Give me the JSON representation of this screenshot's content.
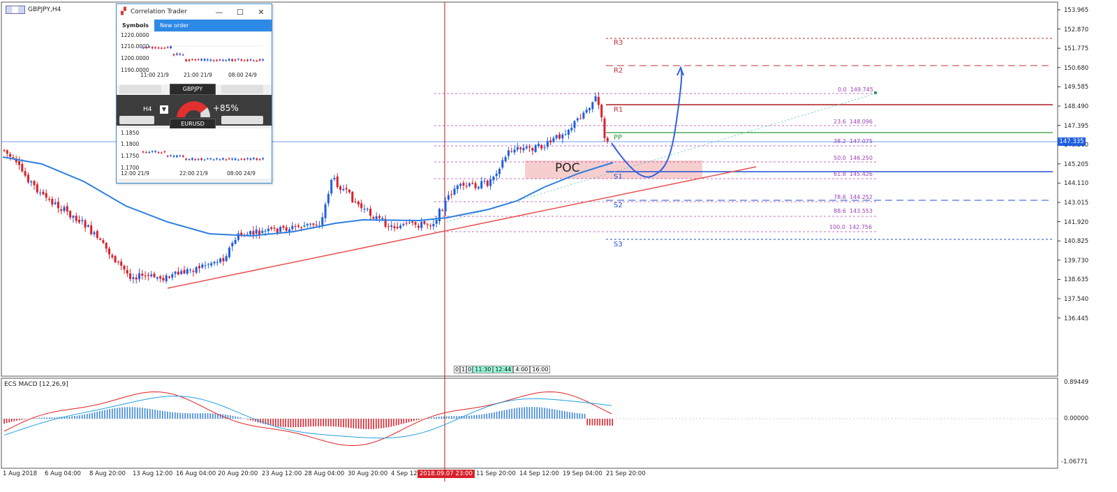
{
  "chart": {
    "symbol_label": "GBPJPY,H4",
    "indicator_label": "ECS MACD [12,26,9]",
    "current_price": "147.335",
    "poc_label": "POC",
    "price_scale": [
      "153.965",
      "152.870",
      "151.775",
      "150.680",
      "149.585",
      "148.490",
      "147.395",
      "146.300",
      "145.205",
      "144.110",
      "143.015",
      "141.920",
      "140.825",
      "139.730",
      "138.635",
      "137.540",
      "136.445"
    ],
    "macd_scale": [
      "0.89449",
      "0.00000",
      "-1.06771"
    ],
    "time_scale": [
      "1 Aug 2018",
      "6 Aug 04:00",
      "8 Aug 20:00",
      "13 Aug 12:00",
      "16 Aug 04:00",
      "20 Aug 20:00",
      "23 Aug 12:00",
      "28 Aug 04:00",
      "30 Aug 20:00",
      "4 Sep 12:00",
      "11 Sep 20:00",
      "14 Sep 12:00",
      "19 Sep 04:00",
      "21 Sep 20:00"
    ],
    "crosshair_time": "2018.09.07 23:00",
    "timer_boxes": [
      "0",
      "1",
      "0",
      "11:30",
      "12:44",
      "4:00",
      "16:00"
    ]
  },
  "pivots": {
    "R3": "R3",
    "R2": "R2",
    "R1": "R1",
    "PP": "PP",
    "S1": "S1",
    "S2": "S2",
    "S3": "S3"
  },
  "fibo": [
    {
      "level": "0.0",
      "price": "149.745"
    },
    {
      "level": "23.6",
      "price": "148.096"
    },
    {
      "level": "38.2",
      "price": "147.075"
    },
    {
      "level": "50.0",
      "price": "146.250"
    },
    {
      "level": "61.8",
      "price": "145.426"
    },
    {
      "level": "78.6",
      "price": "144.252"
    },
    {
      "level": "88.6",
      "price": "143.553"
    },
    {
      "level": "100.0",
      "price": "142.756"
    }
  ],
  "correlation_trader": {
    "title": "Correlation Trader",
    "tabs": [
      "Symbols",
      "New order"
    ],
    "top_chart": {
      "y_labels": [
        "1220.0000",
        "1210.0000",
        "1200.0000",
        "1190.0000"
      ],
      "x_labels": [
        "11:00 21/9",
        "21:00 21/9",
        "08:00 24/9"
      ]
    },
    "symbol_a": "GBPJPY",
    "symbol_b": "EURUSD",
    "timeframe": "H4",
    "correlation": "+85%",
    "bottom_chart": {
      "y_labels": [
        "1.1850",
        "1.1800",
        "1.1750",
        "1.1700"
      ],
      "x_labels": [
        "12:00 21/9",
        "22:00 21/9",
        "08:00 24/9"
      ]
    }
  },
  "colors": {
    "bull": "#1f5fe0",
    "bear": "#d8202a",
    "ma": "#2d7fe0",
    "trend": "#e85050",
    "poc": "#f6c6c6"
  }
}
